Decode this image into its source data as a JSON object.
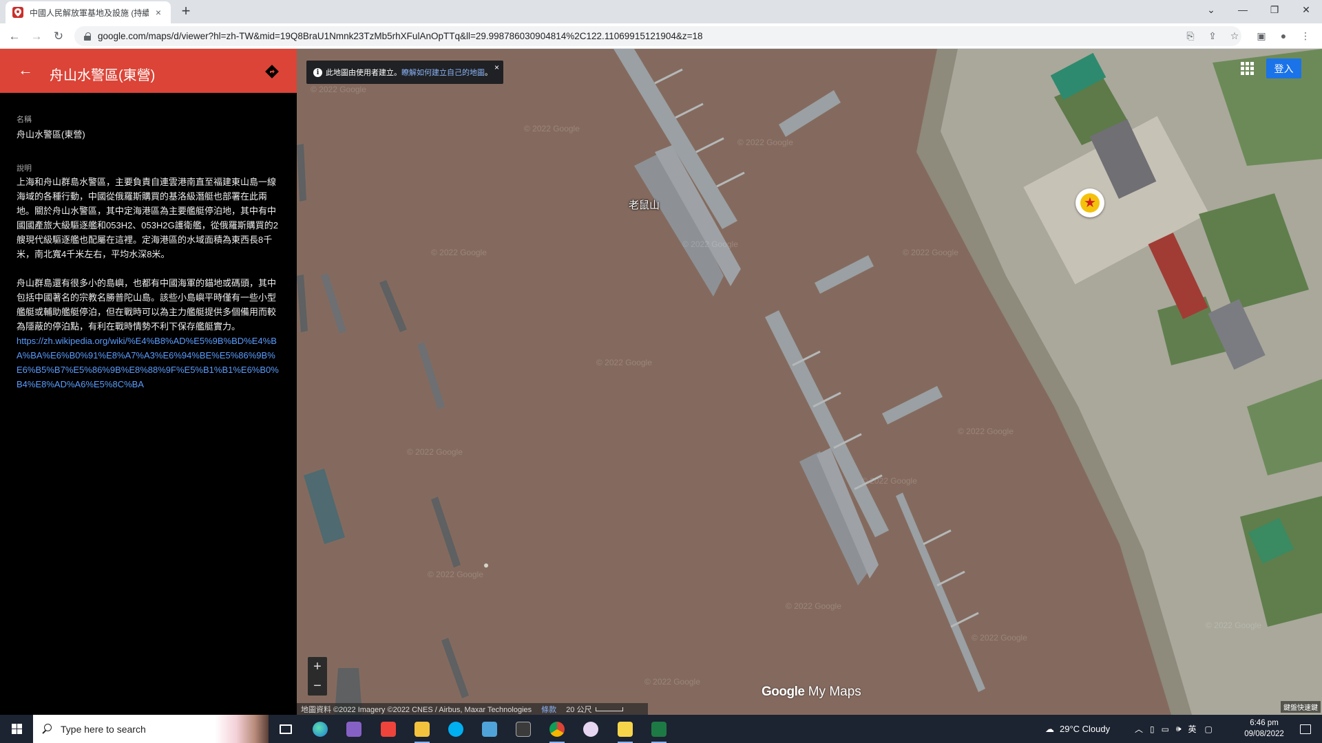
{
  "browser": {
    "tab_title": "中國人民解放軍基地及設施 (持續",
    "tab_close": "×",
    "new_tab": "+",
    "url": "google.com/maps/d/viewer?hl=zh-TW&mid=19Q8BraU1Nmnk23TzMb5rhXFulAnOpTTq&ll=29.998786030904814%2C122.11069915121904&z=18"
  },
  "panel": {
    "title": "舟山水警區(東營)",
    "name_label": "名稱",
    "name_value": "舟山水警區(東營)",
    "desc_label": "說明",
    "desc_p1": "上海和舟山群島水警區，主要負責自連雲港南直至福建東山島一線海域的各種行動，中國從俄羅斯購買的基洛級潛艇也部署在此兩地。關於舟山水警區，其中定海港區為主要艦艇停泊地，其中有中國國產旅大級驅逐艦和053H2、053H2G護衛艦，從俄羅斯購買的2艘現代級驅逐艦也配屬在這裡。定海港區的水域面積為東西長8千米，南北寬4千米左右，平均水深8米。",
    "desc_p2": "舟山群島還有很多小的島嶼，也都有中國海軍的錨地或碼頭，其中包括中國著名的宗教名勝普陀山島。該些小島嶼平時僅有一些小型艦艇或輔助艦艇停泊，但在戰時可以為主力艦艇提供多個備用而較為隱蔽的停泊點，有利在戰時情勢不利下保存艦艇實力。",
    "desc_link": "https://zh.wikipedia.org/wiki/%E4%B8%AD%E5%9B%BD%E4%BA%BA%E6%B0%91%E8%A7%A3%E6%94%BE%E5%86%9B%E6%B5%B7%E5%86%9B%E8%88%9F%E5%B1%B1%E6%B0%B4%E8%AD%A6%E5%8C%BA"
  },
  "map": {
    "banner_text": "此地圖由使用者建立。",
    "banner_link": "瞭解如何建立自己的地圖",
    "banner_dot": "。",
    "banner_close": "×",
    "place_label": "老鼠山",
    "marker_symbol": "★",
    "signin": "登入",
    "zoom_in": "+",
    "zoom_out": "−",
    "logo_google": "Google",
    "logo_mymaps": " My Maps",
    "attribution": "地圖資料 ©2022 Imagery ©2022 CNES / Airbus, Maxar Technologies",
    "terms": "條款",
    "scale": "20 公尺",
    "corner_badge": "鍵盤快速鍵",
    "watermark": "© 2022 Google",
    "colors": {
      "water": "#846a5e",
      "header": "#db4437",
      "signin": "#1a73e8"
    }
  },
  "taskbar": {
    "search_placeholder": "Type here to search",
    "weather": "29°C  Cloudy",
    "ime": "英",
    "time": "6:46 pm",
    "date": "09/08/2022"
  }
}
